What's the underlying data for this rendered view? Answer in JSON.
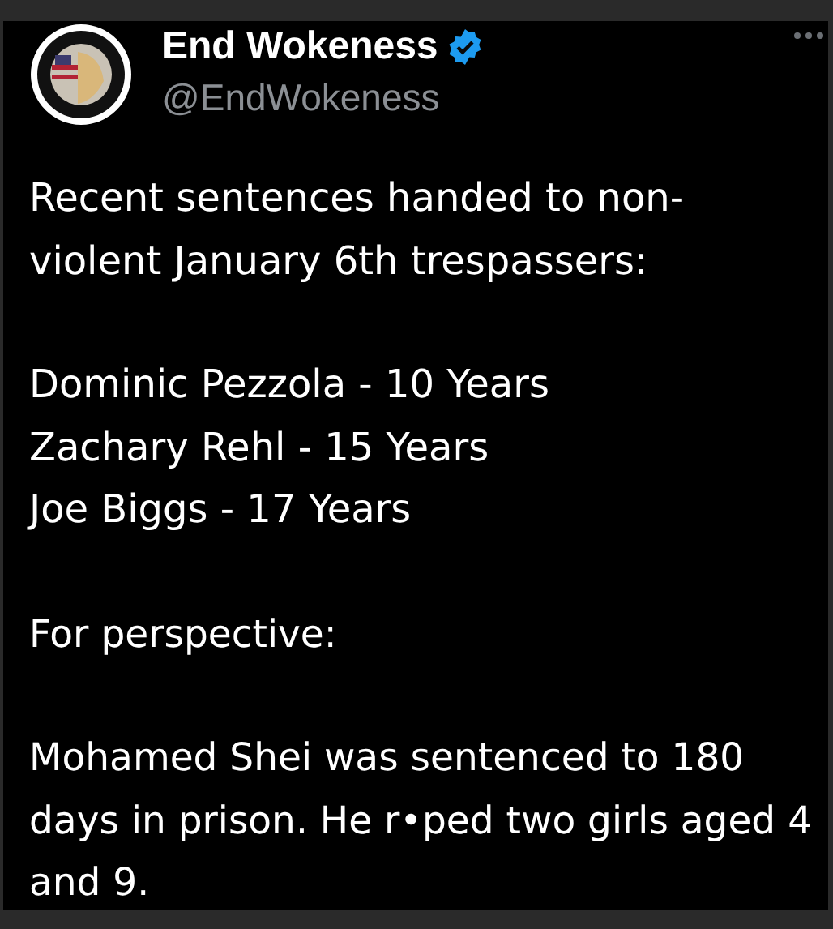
{
  "author": {
    "name": "End Wokeness",
    "verified": true,
    "handle": "@EndWokeness"
  },
  "paragraphs": [
    {
      "kind": "text",
      "text": "Recent sentences handed to non-violent January 6th trespassers:"
    },
    {
      "kind": "list",
      "lines": [
        "Dominic Pezzola - 10 Years",
        "Zachary Rehl - 15 Years",
        "Joe Biggs - 17 Years"
      ]
    },
    {
      "kind": "text",
      "text": "For perspective:"
    },
    {
      "kind": "text",
      "text": "Mohamed Shei was sentenced to 180 days in prison. He r•ped two girls aged 4 and 9."
    }
  ]
}
